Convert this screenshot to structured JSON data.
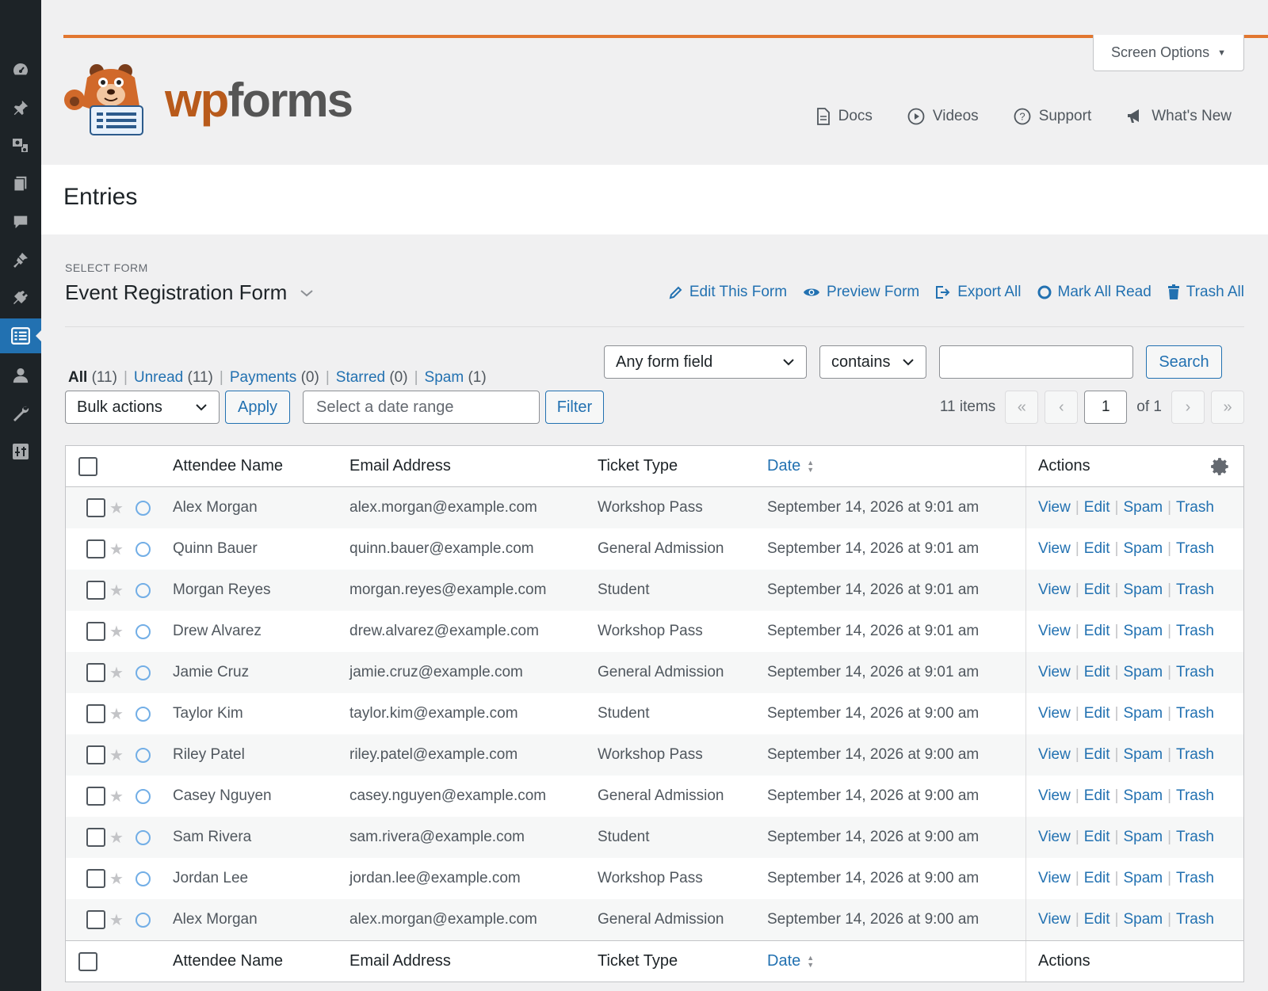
{
  "screen_options": "Screen Options",
  "header_links": [
    {
      "icon": "doc-icon",
      "glyph": "🗎",
      "label": "Docs"
    },
    {
      "icon": "play-icon",
      "glyph": "▶",
      "label": "Videos"
    },
    {
      "icon": "help-icon",
      "glyph": "?",
      "label": "Support"
    },
    {
      "icon": "megaphone-icon",
      "glyph": "📣",
      "label": "What's New"
    }
  ],
  "logo": {
    "wp": "wp",
    "forms": "forms"
  },
  "page_title": "Entries",
  "select_form_label": "SELECT FORM",
  "form_name": "Event Registration Form",
  "form_actions": [
    {
      "icon": "pencil-icon",
      "glyph": "✎",
      "label": "Edit This Form"
    },
    {
      "icon": "eye-icon",
      "glyph": "👁",
      "label": "Preview Form"
    },
    {
      "icon": "export-icon",
      "glyph": "⇥",
      "label": "Export All"
    },
    {
      "icon": "circle-icon",
      "glyph": "○",
      "label": "Mark All Read"
    },
    {
      "icon": "trash-icon",
      "glyph": "🗑",
      "label": "Trash All"
    }
  ],
  "views": [
    {
      "label": "All",
      "count": "(11)",
      "current": true
    },
    {
      "label": "Unread",
      "count": "(11)",
      "current": false
    },
    {
      "label": "Payments",
      "count": "(0)",
      "current": false
    },
    {
      "label": "Starred",
      "count": "(0)",
      "current": false
    },
    {
      "label": "Spam",
      "count": "(1)",
      "current": false
    }
  ],
  "filters": {
    "field_select": "Any form field",
    "operator_select": "contains",
    "search_value": "",
    "search_button": "Search",
    "bulk_actions": "Bulk actions",
    "apply_button": "Apply",
    "date_placeholder": "Select a date range",
    "filter_button": "Filter"
  },
  "pagination": {
    "items": "11 items",
    "first": "«",
    "prev": "‹",
    "current_page": "1",
    "of_total": "of 1",
    "next": "›",
    "last": "»"
  },
  "columns": {
    "name": "Attendee Name",
    "email": "Email Address",
    "ticket": "Ticket Type",
    "date": "Date",
    "actions": "Actions"
  },
  "row_actions": [
    "View",
    "Edit",
    "Spam",
    "Trash"
  ],
  "entries": [
    {
      "name": "Alex Morgan",
      "email": "alex.morgan@example.com",
      "ticket": "Workshop Pass",
      "date": "September 14, 2026 at 9:01 am"
    },
    {
      "name": "Quinn Bauer",
      "email": "quinn.bauer@example.com",
      "ticket": "General Admission",
      "date": "September 14, 2026 at 9:01 am"
    },
    {
      "name": "Morgan Reyes",
      "email": "morgan.reyes@example.com",
      "ticket": "Student",
      "date": "September 14, 2026 at 9:01 am"
    },
    {
      "name": "Drew Alvarez",
      "email": "drew.alvarez@example.com",
      "ticket": "Workshop Pass",
      "date": "September 14, 2026 at 9:01 am"
    },
    {
      "name": "Jamie Cruz",
      "email": "jamie.cruz@example.com",
      "ticket": "General Admission",
      "date": "September 14, 2026 at 9:01 am"
    },
    {
      "name": "Taylor Kim",
      "email": "taylor.kim@example.com",
      "ticket": "Student",
      "date": "September 14, 2026 at 9:00 am"
    },
    {
      "name": "Riley Patel",
      "email": "riley.patel@example.com",
      "ticket": "Workshop Pass",
      "date": "September 14, 2026 at 9:00 am"
    },
    {
      "name": "Casey Nguyen",
      "email": "casey.nguyen@example.com",
      "ticket": "General Admission",
      "date": "September 14, 2026 at 9:00 am"
    },
    {
      "name": "Sam Rivera",
      "email": "sam.rivera@example.com",
      "ticket": "Student",
      "date": "September 14, 2026 at 9:00 am"
    },
    {
      "name": "Jordan Lee",
      "email": "jordan.lee@example.com",
      "ticket": "Workshop Pass",
      "date": "September 14, 2026 at 9:00 am"
    },
    {
      "name": "Alex Morgan",
      "email": "alex.morgan@example.com",
      "ticket": "General Admission",
      "date": "September 14, 2026 at 9:00 am"
    }
  ],
  "sidebar_icons": [
    "dashboard-icon",
    "pin-icon",
    "media-icon",
    "pages-icon",
    "comments-icon",
    "appearance-icon",
    "plugins-icon",
    "wpforms-icon",
    "users-icon",
    "tools-icon",
    "settings-icon"
  ],
  "colors": {
    "accent": "#2271b1",
    "brand_orange": "#e27730",
    "sidebar": "#1d2327"
  }
}
